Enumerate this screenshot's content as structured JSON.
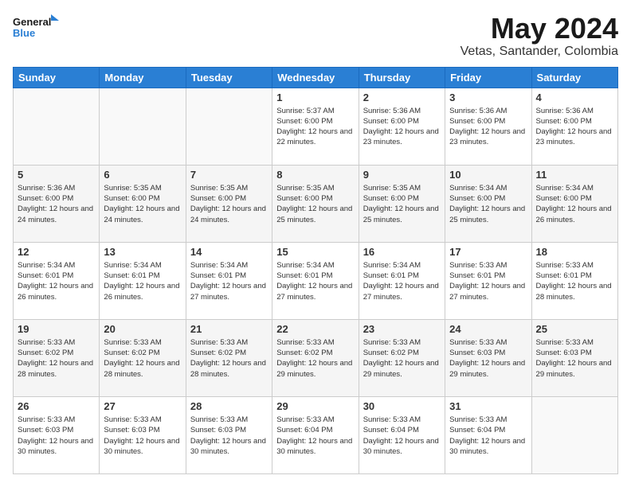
{
  "header": {
    "logo_general": "General",
    "logo_blue": "Blue",
    "title": "May 2024",
    "subtitle": "Vetas, Santander, Colombia"
  },
  "days_of_week": [
    "Sunday",
    "Monday",
    "Tuesday",
    "Wednesday",
    "Thursday",
    "Friday",
    "Saturday"
  ],
  "weeks": [
    [
      {
        "day": "",
        "info": ""
      },
      {
        "day": "",
        "info": ""
      },
      {
        "day": "",
        "info": ""
      },
      {
        "day": "1",
        "info": "Sunrise: 5:37 AM\nSunset: 6:00 PM\nDaylight: 12 hours\nand 22 minutes."
      },
      {
        "day": "2",
        "info": "Sunrise: 5:36 AM\nSunset: 6:00 PM\nDaylight: 12 hours\nand 23 minutes."
      },
      {
        "day": "3",
        "info": "Sunrise: 5:36 AM\nSunset: 6:00 PM\nDaylight: 12 hours\nand 23 minutes."
      },
      {
        "day": "4",
        "info": "Sunrise: 5:36 AM\nSunset: 6:00 PM\nDaylight: 12 hours\nand 23 minutes."
      }
    ],
    [
      {
        "day": "5",
        "info": "Sunrise: 5:36 AM\nSunset: 6:00 PM\nDaylight: 12 hours\nand 24 minutes."
      },
      {
        "day": "6",
        "info": "Sunrise: 5:35 AM\nSunset: 6:00 PM\nDaylight: 12 hours\nand 24 minutes."
      },
      {
        "day": "7",
        "info": "Sunrise: 5:35 AM\nSunset: 6:00 PM\nDaylight: 12 hours\nand 24 minutes."
      },
      {
        "day": "8",
        "info": "Sunrise: 5:35 AM\nSunset: 6:00 PM\nDaylight: 12 hours\nand 25 minutes."
      },
      {
        "day": "9",
        "info": "Sunrise: 5:35 AM\nSunset: 6:00 PM\nDaylight: 12 hours\nand 25 minutes."
      },
      {
        "day": "10",
        "info": "Sunrise: 5:34 AM\nSunset: 6:00 PM\nDaylight: 12 hours\nand 25 minutes."
      },
      {
        "day": "11",
        "info": "Sunrise: 5:34 AM\nSunset: 6:00 PM\nDaylight: 12 hours\nand 26 minutes."
      }
    ],
    [
      {
        "day": "12",
        "info": "Sunrise: 5:34 AM\nSunset: 6:01 PM\nDaylight: 12 hours\nand 26 minutes."
      },
      {
        "day": "13",
        "info": "Sunrise: 5:34 AM\nSunset: 6:01 PM\nDaylight: 12 hours\nand 26 minutes."
      },
      {
        "day": "14",
        "info": "Sunrise: 5:34 AM\nSunset: 6:01 PM\nDaylight: 12 hours\nand 27 minutes."
      },
      {
        "day": "15",
        "info": "Sunrise: 5:34 AM\nSunset: 6:01 PM\nDaylight: 12 hours\nand 27 minutes."
      },
      {
        "day": "16",
        "info": "Sunrise: 5:34 AM\nSunset: 6:01 PM\nDaylight: 12 hours\nand 27 minutes."
      },
      {
        "day": "17",
        "info": "Sunrise: 5:33 AM\nSunset: 6:01 PM\nDaylight: 12 hours\nand 27 minutes."
      },
      {
        "day": "18",
        "info": "Sunrise: 5:33 AM\nSunset: 6:01 PM\nDaylight: 12 hours\nand 28 minutes."
      }
    ],
    [
      {
        "day": "19",
        "info": "Sunrise: 5:33 AM\nSunset: 6:02 PM\nDaylight: 12 hours\nand 28 minutes."
      },
      {
        "day": "20",
        "info": "Sunrise: 5:33 AM\nSunset: 6:02 PM\nDaylight: 12 hours\nand 28 minutes."
      },
      {
        "day": "21",
        "info": "Sunrise: 5:33 AM\nSunset: 6:02 PM\nDaylight: 12 hours\nand 28 minutes."
      },
      {
        "day": "22",
        "info": "Sunrise: 5:33 AM\nSunset: 6:02 PM\nDaylight: 12 hours\nand 29 minutes."
      },
      {
        "day": "23",
        "info": "Sunrise: 5:33 AM\nSunset: 6:02 PM\nDaylight: 12 hours\nand 29 minutes."
      },
      {
        "day": "24",
        "info": "Sunrise: 5:33 AM\nSunset: 6:03 PM\nDaylight: 12 hours\nand 29 minutes."
      },
      {
        "day": "25",
        "info": "Sunrise: 5:33 AM\nSunset: 6:03 PM\nDaylight: 12 hours\nand 29 minutes."
      }
    ],
    [
      {
        "day": "26",
        "info": "Sunrise: 5:33 AM\nSunset: 6:03 PM\nDaylight: 12 hours\nand 30 minutes."
      },
      {
        "day": "27",
        "info": "Sunrise: 5:33 AM\nSunset: 6:03 PM\nDaylight: 12 hours\nand 30 minutes."
      },
      {
        "day": "28",
        "info": "Sunrise: 5:33 AM\nSunset: 6:03 PM\nDaylight: 12 hours\nand 30 minutes."
      },
      {
        "day": "29",
        "info": "Sunrise: 5:33 AM\nSunset: 6:04 PM\nDaylight: 12 hours\nand 30 minutes."
      },
      {
        "day": "30",
        "info": "Sunrise: 5:33 AM\nSunset: 6:04 PM\nDaylight: 12 hours\nand 30 minutes."
      },
      {
        "day": "31",
        "info": "Sunrise: 5:33 AM\nSunset: 6:04 PM\nDaylight: 12 hours\nand 30 minutes."
      },
      {
        "day": "",
        "info": ""
      }
    ]
  ]
}
